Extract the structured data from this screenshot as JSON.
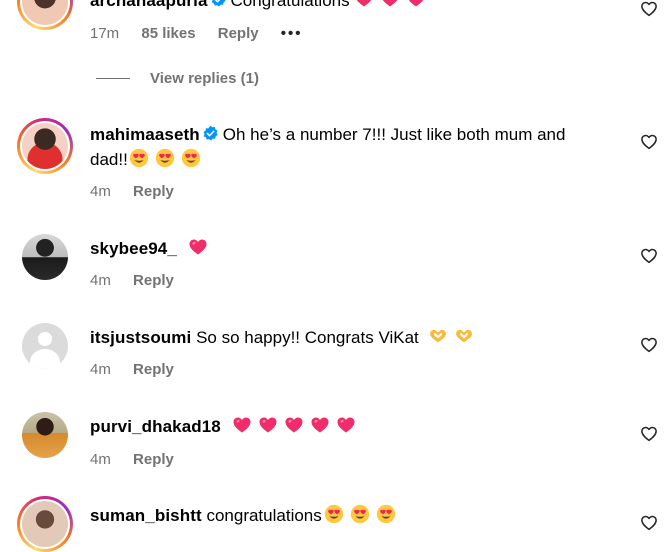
{
  "comments": [
    {
      "username": "archanaapuria",
      "text": "Congratulations",
      "time": "17m",
      "likes": "85 likes",
      "reply": "Reply",
      "more": "•••",
      "view_replies": "View replies (1)"
    },
    {
      "username": "mahimaaseth",
      "text_line1": "Oh he’s a number 7!!! Just like both mum and",
      "text_line2": "dad!!",
      "time": "4m",
      "reply": "Reply"
    },
    {
      "username": "skybee94_",
      "time": "4m",
      "reply": "Reply"
    },
    {
      "username": "itsjustsoumi",
      "text": "So so happy!! Congrats ViKat",
      "time": "4m",
      "reply": "Reply"
    },
    {
      "username": "purvi_dhakad18",
      "time": "4m",
      "reply": "Reply"
    },
    {
      "username": "suman_bishtt",
      "text": "congratulations"
    }
  ],
  "colors": {
    "meta_gray": "#737373",
    "verified_blue": "#0095f6",
    "heart_pink": "#f02d6a"
  },
  "icons": {
    "like": "heart-outline-icon",
    "verified": "verified-badge-icon",
    "heart_eyes": "heart-eyes-emoji",
    "pink_heart": "pink-heart-emoji",
    "heart_hands": "heart-hands-emoji"
  }
}
